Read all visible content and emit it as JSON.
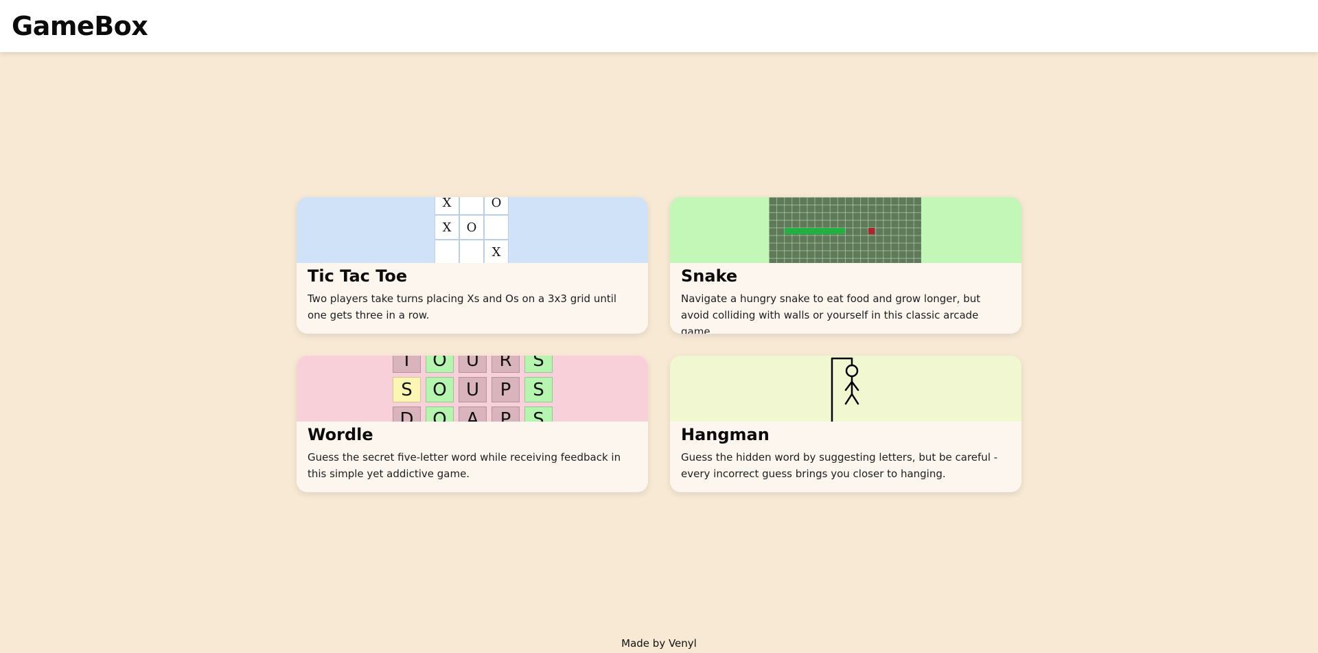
{
  "header": {
    "logo": "GameBox"
  },
  "games": {
    "tictactoe": {
      "title": "Tic Tac Toe",
      "description": "Two players take turns placing Xs and Os on a 3x3 grid until one gets three in a row.",
      "preview_bg": "#cfe2f8",
      "board": [
        [
          "X",
          "",
          "O"
        ],
        [
          "X",
          "O",
          ""
        ],
        [
          "",
          "",
          "X"
        ]
      ]
    },
    "snake": {
      "title": "Snake",
      "description": "Navigate a hungry snake to eat food and grow longer, but avoid colliding with walls or yourself in this classic arcade game.",
      "preview_bg": "#c3f7b7",
      "board_color": "#5f7a59",
      "snake_color": "#22b043",
      "food_color": "#b3202e"
    },
    "wordle": {
      "title": "Wordle",
      "description": "Guess the secret five-letter word while receiving feedback in this simple yet addictive game.",
      "preview_bg": "#f8d0d9",
      "rows": [
        [
          {
            "l": "T",
            "s": "absent"
          },
          {
            "l": "O",
            "s": "correct"
          },
          {
            "l": "U",
            "s": "absent"
          },
          {
            "l": "R",
            "s": "absent"
          },
          {
            "l": "S",
            "s": "correct"
          }
        ],
        [
          {
            "l": "S",
            "s": "present"
          },
          {
            "l": "O",
            "s": "correct"
          },
          {
            "l": "U",
            "s": "absent"
          },
          {
            "l": "P",
            "s": "absent"
          },
          {
            "l": "S",
            "s": "correct"
          }
        ],
        [
          {
            "l": "D",
            "s": "absent"
          },
          {
            "l": "O",
            "s": "correct"
          },
          {
            "l": "A",
            "s": "absent"
          },
          {
            "l": "P",
            "s": "absent"
          },
          {
            "l": "S",
            "s": "correct"
          }
        ]
      ],
      "colors": {
        "absent": "#d9b4bc",
        "correct": "#b6f5b0",
        "present": "#fbf6b4"
      }
    },
    "hangman": {
      "title": "Hangman",
      "description": "Guess the hidden word by suggesting letters, but be careful - every incorrect guess brings you closer to hanging.",
      "preview_bg": "#f1f8d1"
    }
  },
  "footer": {
    "text": "Made by Venyl"
  }
}
